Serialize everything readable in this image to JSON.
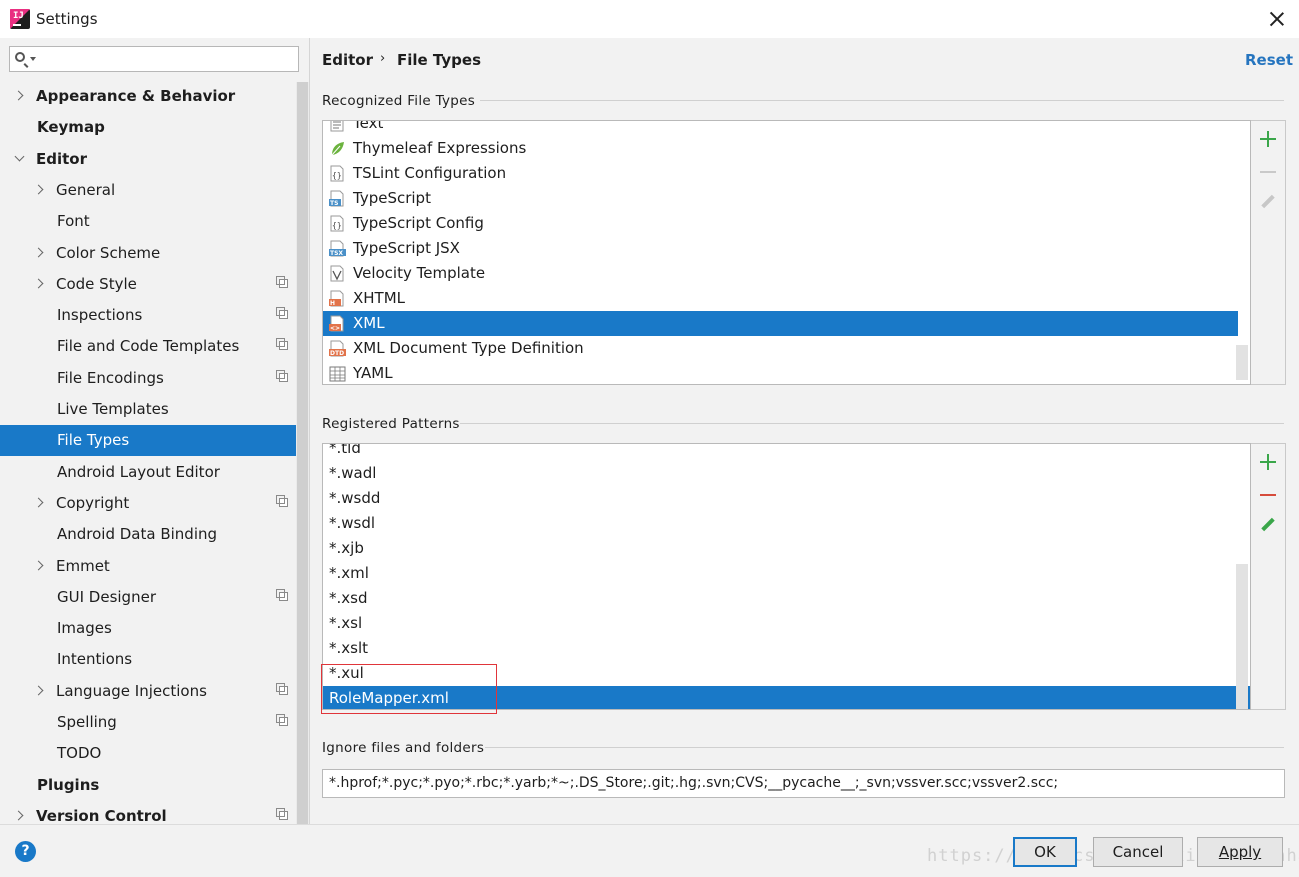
{
  "window": {
    "title": "Settings"
  },
  "search": {
    "placeholder": ""
  },
  "sidebar": {
    "items": [
      {
        "label": "Appearance & Behavior",
        "level": 0,
        "expander": "collapsed",
        "bold": true,
        "project": false
      },
      {
        "label": "Keymap",
        "level": 0,
        "expander": "none",
        "bold": true,
        "project": false
      },
      {
        "label": "Editor",
        "level": 0,
        "expander": "expanded",
        "bold": true,
        "project": false
      },
      {
        "label": "General",
        "level": 1,
        "expander": "collapsed",
        "bold": false,
        "project": false
      },
      {
        "label": "Font",
        "level": 1,
        "expander": "none",
        "bold": false,
        "project": false
      },
      {
        "label": "Color Scheme",
        "level": 1,
        "expander": "collapsed",
        "bold": false,
        "project": false
      },
      {
        "label": "Code Style",
        "level": 1,
        "expander": "collapsed",
        "bold": false,
        "project": true
      },
      {
        "label": "Inspections",
        "level": 1,
        "expander": "none",
        "bold": false,
        "project": true
      },
      {
        "label": "File and Code Templates",
        "level": 1,
        "expander": "none",
        "bold": false,
        "project": true
      },
      {
        "label": "File Encodings",
        "level": 1,
        "expander": "none",
        "bold": false,
        "project": true
      },
      {
        "label": "Live Templates",
        "level": 1,
        "expander": "none",
        "bold": false,
        "project": false
      },
      {
        "label": "File Types",
        "level": 1,
        "expander": "none",
        "bold": false,
        "project": false,
        "selected": true
      },
      {
        "label": "Android Layout Editor",
        "level": 1,
        "expander": "none",
        "bold": false,
        "project": false
      },
      {
        "label": "Copyright",
        "level": 1,
        "expander": "collapsed",
        "bold": false,
        "project": true
      },
      {
        "label": "Android Data Binding",
        "level": 1,
        "expander": "none",
        "bold": false,
        "project": false
      },
      {
        "label": "Emmet",
        "level": 1,
        "expander": "collapsed",
        "bold": false,
        "project": false
      },
      {
        "label": "GUI Designer",
        "level": 1,
        "expander": "none",
        "bold": false,
        "project": true
      },
      {
        "label": "Images",
        "level": 1,
        "expander": "none",
        "bold": false,
        "project": false
      },
      {
        "label": "Intentions",
        "level": 1,
        "expander": "none",
        "bold": false,
        "project": false
      },
      {
        "label": "Language Injections",
        "level": 1,
        "expander": "collapsed",
        "bold": false,
        "project": true
      },
      {
        "label": "Spelling",
        "level": 1,
        "expander": "none",
        "bold": false,
        "project": true
      },
      {
        "label": "TODO",
        "level": 1,
        "expander": "none",
        "bold": false,
        "project": false
      },
      {
        "label": "Plugins",
        "level": 0,
        "expander": "none",
        "bold": true,
        "project": false
      },
      {
        "label": "Version Control",
        "level": 0,
        "expander": "collapsed",
        "bold": true,
        "project": true
      }
    ]
  },
  "breadcrumb": {
    "parent": "Editor",
    "separator": "›",
    "current": "File Types"
  },
  "reset_label": "Reset",
  "recognized": {
    "title": "Recognized File Types",
    "items": [
      {
        "label": "Text",
        "icon": "text-file-icon"
      },
      {
        "label": "Thymeleaf Expressions",
        "icon": "thymeleaf-leaf-icon"
      },
      {
        "label": "TSLint Configuration",
        "icon": "json-file-icon"
      },
      {
        "label": "TypeScript",
        "icon": "typescript-file-icon",
        "badge": "TS"
      },
      {
        "label": "TypeScript Config",
        "icon": "json-file-icon"
      },
      {
        "label": "TypeScript JSX",
        "icon": "tsx-file-icon",
        "badge": "TSX"
      },
      {
        "label": "Velocity Template",
        "icon": "velocity-file-icon"
      },
      {
        "label": "XHTML",
        "icon": "xhtml-file-icon",
        "badge": "H"
      },
      {
        "label": "XML",
        "icon": "xml-file-icon",
        "badge": "<>",
        "selected": true
      },
      {
        "label": "XML Document Type Definition",
        "icon": "dtd-file-icon",
        "badge": "DTD"
      },
      {
        "label": "YAML",
        "icon": "yaml-table-icon"
      }
    ]
  },
  "patterns": {
    "title": "Registered Patterns",
    "items": [
      {
        "label": "*.tld"
      },
      {
        "label": "*.wadl"
      },
      {
        "label": "*.wsdd"
      },
      {
        "label": "*.wsdl"
      },
      {
        "label": "*.xjb"
      },
      {
        "label": "*.xml"
      },
      {
        "label": "*.xsd"
      },
      {
        "label": "*.xsl"
      },
      {
        "label": "*.xslt"
      },
      {
        "label": "*.xul"
      },
      {
        "label": "RoleMapper.xml",
        "selected": true
      }
    ]
  },
  "ignore": {
    "title": "Ignore files and folders",
    "value": "*.hprof;*.pyc;*.pyo;*.rbc;*.yarb;*~;.DS_Store;.git;.hg;.svn;CVS;__pycache__;_svn;vssver.scc;vssver2.scc;"
  },
  "buttons": {
    "help": "?",
    "ok": "OK",
    "cancel": "Cancel",
    "apply": "Apply"
  },
  "watermark": "https://blog.csdn.net/xiaobing_hhaai",
  "colors": {
    "accent": "#1979c8",
    "link": "#2675bf",
    "add": "#3aa64a",
    "remove": "#d64c3c",
    "highlight": "#e0353a"
  }
}
